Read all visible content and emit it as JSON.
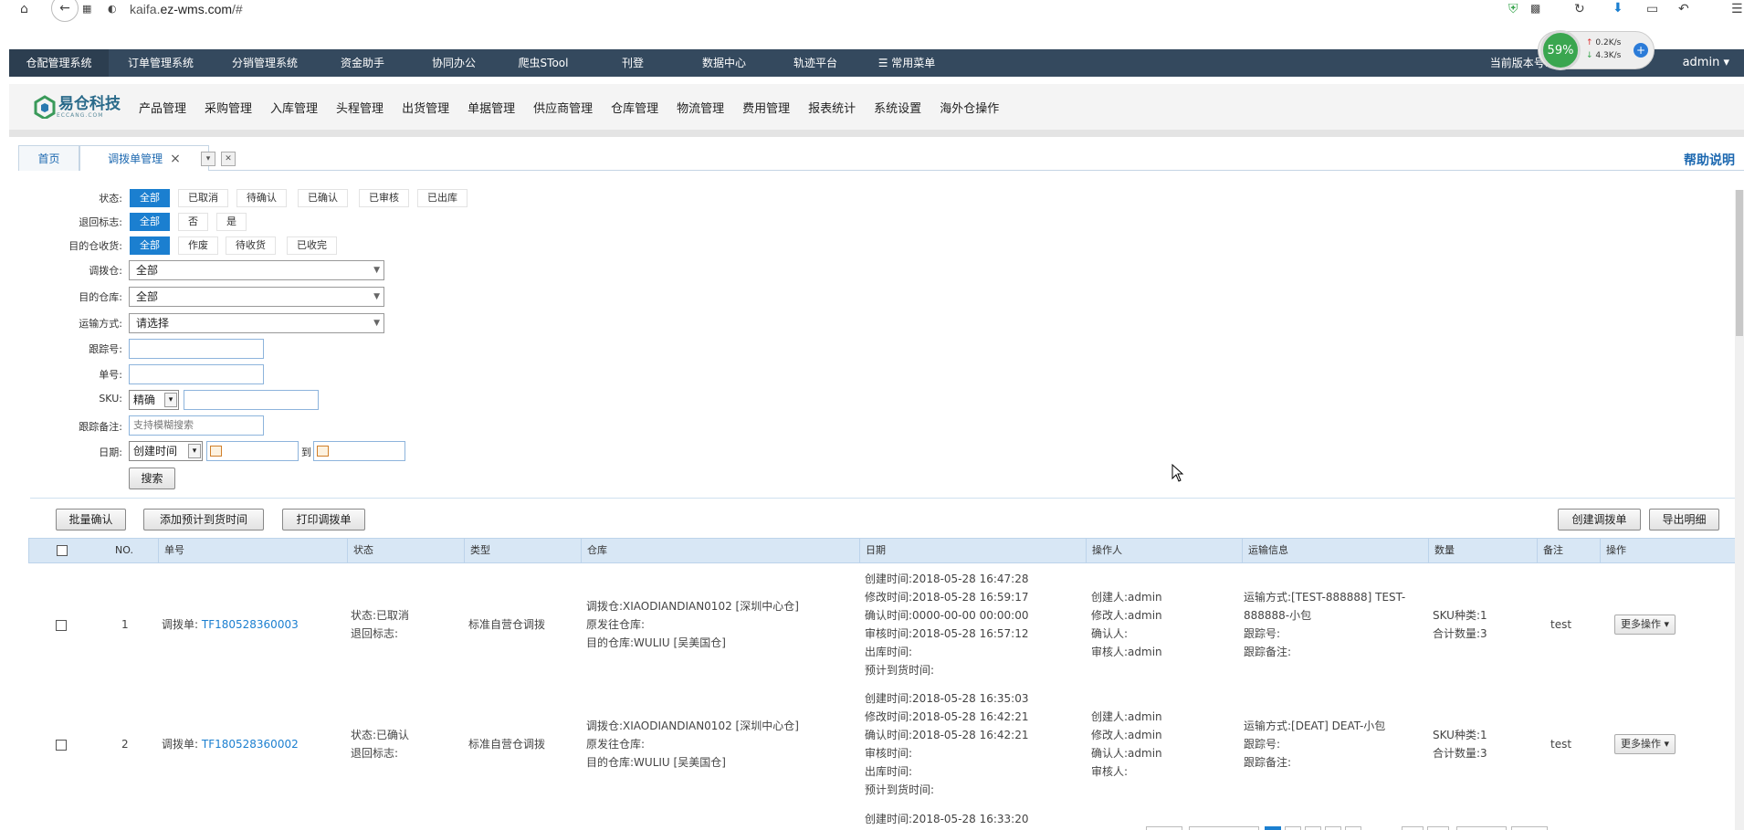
{
  "browser": {
    "url_host_prefix": "kaifa.",
    "url_host_main": "ez-wms.com",
    "url_path": "/#"
  },
  "speed_widget": {
    "percent": "59%",
    "upload": "0.2K/s",
    "download": "4.3K/s"
  },
  "top_nav": {
    "items": [
      "仓配管理系统",
      "订单管理系统",
      "分销管理系统",
      "资金助手",
      "协同办公",
      "爬虫STool",
      "刊登",
      "数据中心",
      "轨迹平台",
      "☰ 常用菜单"
    ],
    "version_label": "当前版本号:D",
    "user": "admin"
  },
  "logo": {
    "name": "易仓科技",
    "sub": "ECCANG.COM"
  },
  "module_nav": [
    "产品管理",
    "采购管理",
    "入库管理",
    "头程管理",
    "出货管理",
    "单据管理",
    "供应商管理",
    "仓库管理",
    "物流管理",
    "费用管理",
    "报表统计",
    "系统设置",
    "海外仓操作"
  ],
  "tabs": {
    "home": "首页",
    "active": "调拨单管理",
    "close": "×",
    "help": "帮助说明"
  },
  "filters": {
    "status_label": "状态:",
    "status_options": [
      "全部",
      "已取消",
      "待确认",
      "已确认",
      "已审核",
      "已出库"
    ],
    "return_label": "退回标志:",
    "return_options": [
      "全部",
      "否",
      "是"
    ],
    "dest_receive_label": "目的仓收货:",
    "dest_receive_options": [
      "全部",
      "作废",
      "待收货",
      "已收完"
    ],
    "from_wh_label": "调拨仓:",
    "from_wh_value": "全部",
    "dest_wh_label": "目的仓库:",
    "dest_wh_value": "全部",
    "ship_label": "运输方式:",
    "ship_value": "请选择",
    "tracking_label": "跟踪号:",
    "order_label": "单号:",
    "sku_label": "SKU:",
    "sku_mode": "精确",
    "remark_label": "跟踪备注:",
    "remark_placeholder": "支持模糊搜索",
    "date_label": "日期:",
    "date_type": "创建时间",
    "date_to": "到",
    "search_btn": "搜索"
  },
  "toolbar": {
    "batch_confirm": "批量确认",
    "add_eta": "添加预计到货时间",
    "print": "打印调拨单",
    "create": "创建调拨单",
    "export": "导出明细"
  },
  "table": {
    "headers": [
      "NO.",
      "单号",
      "状态",
      "类型",
      "仓库",
      "日期",
      "操作人",
      "运输信息",
      "数量",
      "备注",
      "操作"
    ],
    "rows": [
      {
        "no": "1",
        "order_prefix": "调拨单:",
        "order_no": "TF180528360003",
        "status": "状态:已取消",
        "return_flag": "退回标志:",
        "type": "标准自营仓调拨",
        "wh_from": "调拨仓:XIAODIANDIAN0102 [深圳中心仓]",
        "wh_origin": "原发往仓库:",
        "wh_dest": "目的仓库:WULIU [吴美国仓]",
        "dates": [
          "创建时间:2018-05-28 16:47:28",
          "修改时间:2018-05-28 16:59:17",
          "确认时间:0000-00-00 00:00:00",
          "审核时间:2018-05-28 16:57:12",
          "出库时间:",
          "预计到货时间:"
        ],
        "operators": [
          "创建人:admin",
          "修改人:admin",
          "确认人:",
          "审核人:admin"
        ],
        "shipping": [
          "运输方式:[TEST-888888] TEST-",
          "888888-小包",
          "跟踪号:",
          "跟踪备注:"
        ],
        "qty": [
          "SKU种类:1",
          "合计数量:3"
        ],
        "remark": "test",
        "action": "更多操作"
      },
      {
        "no": "2",
        "order_prefix": "调拨单:",
        "order_no": "TF180528360002",
        "status": "状态:已确认",
        "return_flag": "退回标志:",
        "type": "标准自营仓调拨",
        "wh_from": "调拨仓:XIAODIANDIAN0102 [深圳中心仓]",
        "wh_origin": "原发往仓库:",
        "wh_dest": "目的仓库:WULIU [吴美国仓]",
        "dates": [
          "创建时间:2018-05-28 16:35:03",
          "修改时间:2018-05-28 16:42:21",
          "确认时间:2018-05-28 16:42:21",
          "审核时间:",
          "出库时间:",
          "预计到货时间:"
        ],
        "operators": [
          "创建人:admin",
          "修改人:admin",
          "确认人:admin",
          "审核人:"
        ],
        "shipping": [
          "运输方式:[DEAT] DEAT-小包",
          "跟踪号:",
          "跟踪备注:"
        ],
        "qty": [
          "SKU种类:1",
          "合计数量:3"
        ],
        "remark": "test",
        "action": "更多操作"
      }
    ],
    "partial_row_date": "创建时间:2018-05-28 16:33:20"
  }
}
